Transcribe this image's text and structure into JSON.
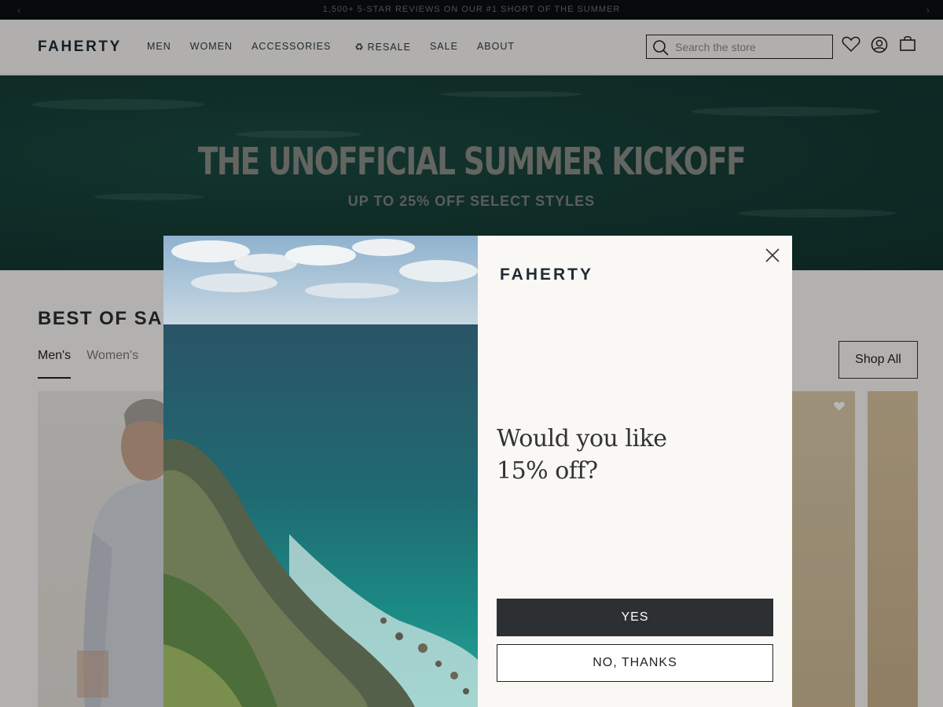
{
  "announcement": {
    "text": "1,500+ 5-STAR REVIEWS ON OUR #1 SHORT OF THE SUMMER",
    "prev_icon": "chevron-left-icon",
    "next_icon": "chevron-right-icon"
  },
  "header": {
    "logo": "FAHERTY",
    "nav": [
      "MEN",
      "WOMEN",
      "ACCESSORIES",
      "RESALE",
      "SALE",
      "ABOUT"
    ],
    "resale_icon": "recycle-icon",
    "search_placeholder": "Search the store",
    "icons": [
      "search-icon",
      "heart-icon",
      "account-icon",
      "bag-icon"
    ]
  },
  "hero": {
    "title": "THE UNOFFICIAL SUMMER KICKOFF",
    "subtitle": "UP TO 25% OFF SELECT STYLES"
  },
  "section": {
    "title": "BEST OF SAL",
    "tabs": [
      "Men's",
      "Women's"
    ],
    "active_tab": "Men's",
    "shop_all": "Shop All"
  },
  "modal": {
    "logo": "FAHERTY",
    "headline_line1": "Would you like",
    "headline_line2": "15% off?",
    "yes_label": "YES",
    "no_label": "NO, THANKS",
    "close_icon": "close-icon"
  },
  "colors": {
    "announce_bg": "#0a0e0e",
    "hero_bg": "#163e37",
    "yes_button": "#2c3032",
    "modal_bg": "#faf8f4"
  }
}
